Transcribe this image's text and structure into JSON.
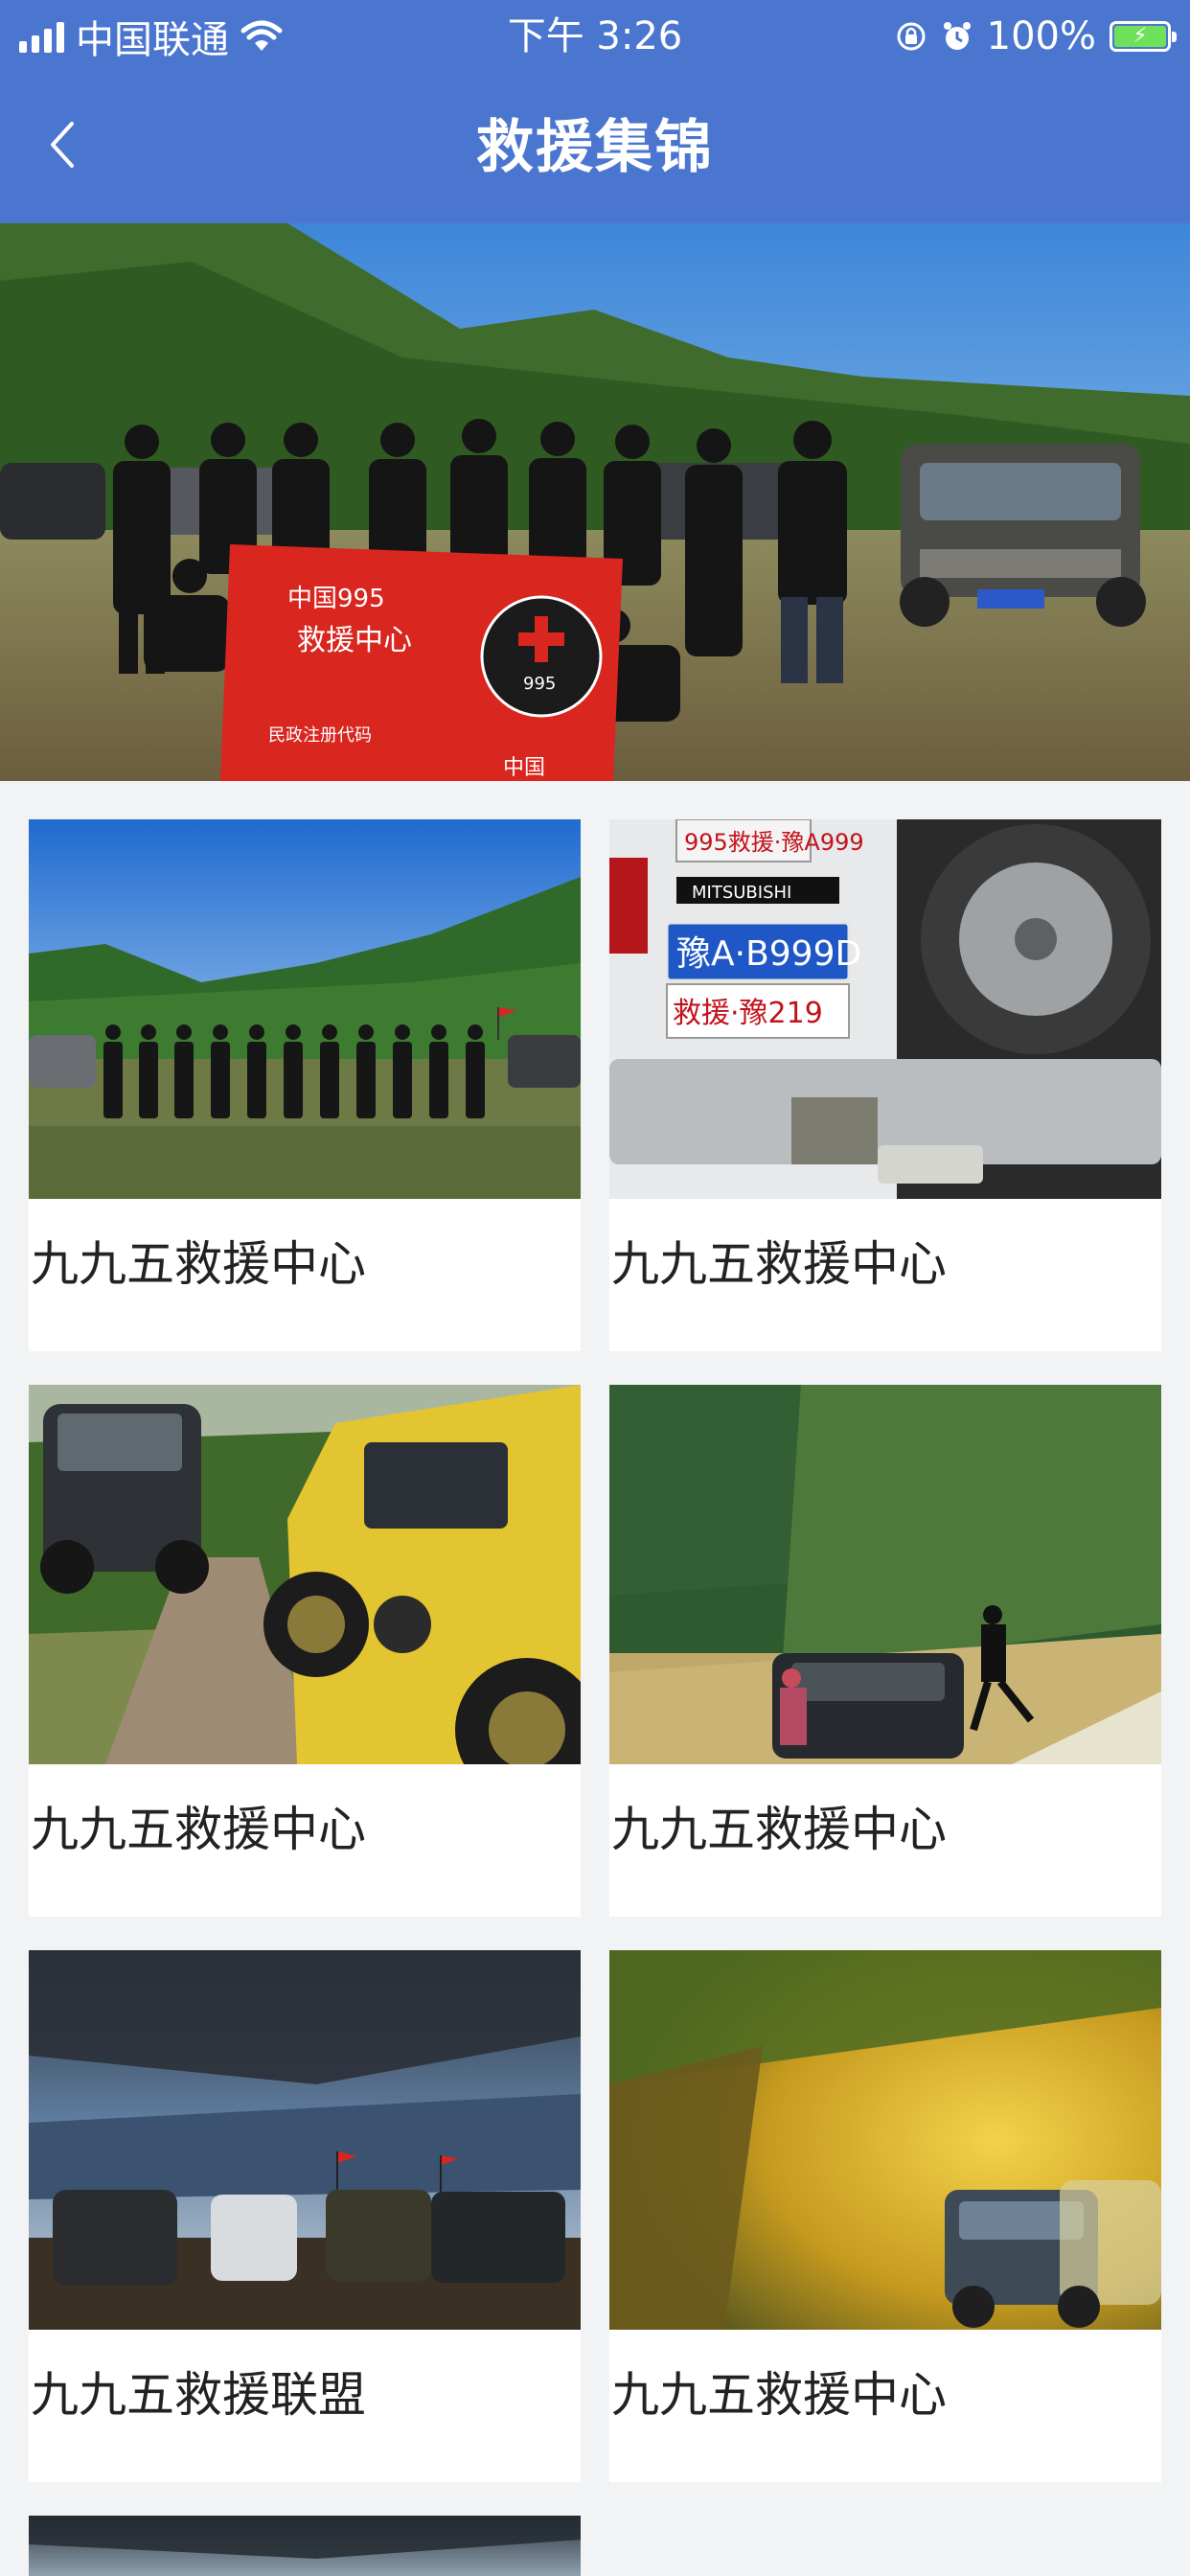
{
  "status_bar": {
    "carrier": "中国联通",
    "time": "下午 3:26",
    "battery_percent": "100%",
    "icons": [
      "signal-icon",
      "wifi-icon",
      "orientation-lock-icon",
      "alarm-icon",
      "battery-charging-icon"
    ]
  },
  "nav": {
    "title": "救援集锦",
    "back_icon": "chevron-left-icon"
  },
  "banner": {
    "flag_line1": "中国995",
    "flag_line2": "救援中心",
    "flag_line3": "民政注册代码",
    "flag_bottom": "中国",
    "emblem_text": "995"
  },
  "cards": [
    {
      "caption": "九九五救援中心"
    },
    {
      "caption": "九九五救援中心",
      "plate_top": "995救援·豫A999",
      "plate_main": "豫A·B999D",
      "plate_bottom": "救援·豫219",
      "brand": "MITSUBISHI"
    },
    {
      "caption": "九九五救援中心"
    },
    {
      "caption": "九九五救援中心"
    },
    {
      "caption": "九九五救援联盟"
    },
    {
      "caption": "九九五救援中心"
    }
  ],
  "colors": {
    "header_bg": "#4a76d0",
    "page_bg": "#f2f3f5",
    "card_bg": "#ffffff",
    "caption_text": "#222222"
  }
}
